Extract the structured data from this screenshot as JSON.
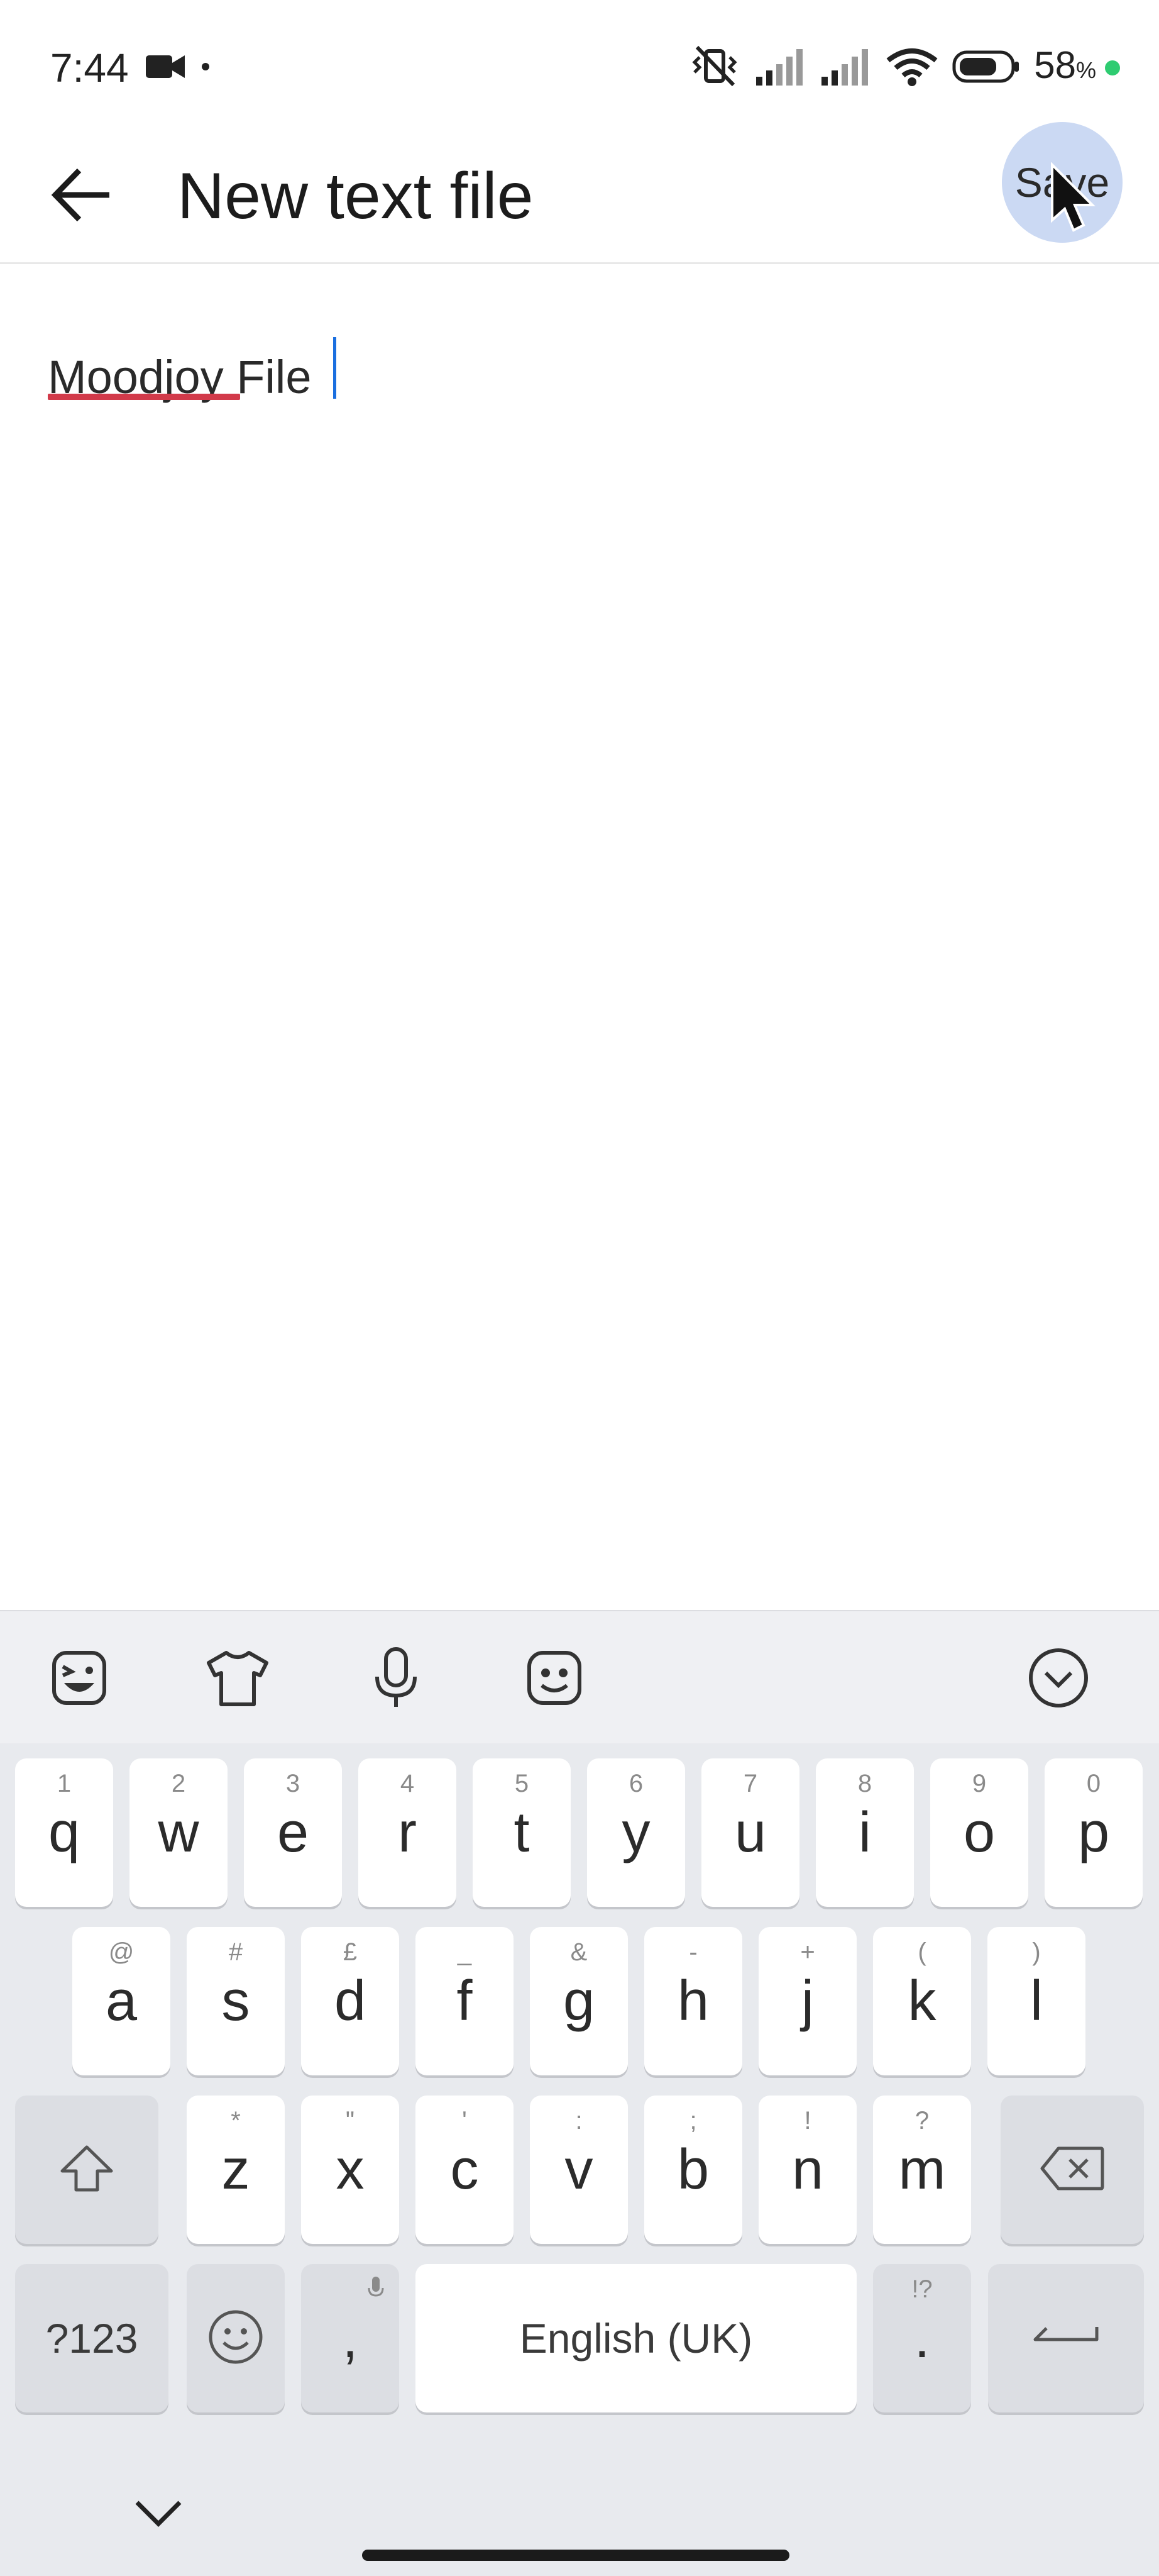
{
  "status_bar": {
    "time": "7:44",
    "battery_percent": "58",
    "battery_unit": "%",
    "icons": [
      "video-camera-icon",
      "notification-dot-icon",
      "vibrate-off-icon",
      "signal-icon",
      "signal-icon",
      "wifi-icon",
      "battery-icon",
      "charging-dot-icon"
    ]
  },
  "app_bar": {
    "title": "New text file",
    "back_icon": "arrow-left-icon",
    "save_label": "Save"
  },
  "editor": {
    "text": "Moodjoy File",
    "misspelled_word": "Moodjoy"
  },
  "keyboard": {
    "toolbar_icons": [
      "sticker-face-icon",
      "tshirt-theme-icon",
      "microphone-icon",
      "emoji-face-icon",
      "collapse-circle-icon"
    ],
    "row1": [
      {
        "key": "q",
        "hint": "1"
      },
      {
        "key": "w",
        "hint": "2"
      },
      {
        "key": "e",
        "hint": "3"
      },
      {
        "key": "r",
        "hint": "4"
      },
      {
        "key": "t",
        "hint": "5"
      },
      {
        "key": "y",
        "hint": "6"
      },
      {
        "key": "u",
        "hint": "7"
      },
      {
        "key": "i",
        "hint": "8"
      },
      {
        "key": "o",
        "hint": "9"
      },
      {
        "key": "p",
        "hint": "0"
      }
    ],
    "row2": [
      {
        "key": "a",
        "hint": "@"
      },
      {
        "key": "s",
        "hint": "#"
      },
      {
        "key": "d",
        "hint": "£"
      },
      {
        "key": "f",
        "hint": "_"
      },
      {
        "key": "g",
        "hint": "&"
      },
      {
        "key": "h",
        "hint": "-"
      },
      {
        "key": "j",
        "hint": "+"
      },
      {
        "key": "k",
        "hint": "("
      },
      {
        "key": "l",
        "hint": ")"
      }
    ],
    "row3": [
      {
        "key": "z",
        "hint": "*"
      },
      {
        "key": "x",
        "hint": "\""
      },
      {
        "key": "c",
        "hint": "'"
      },
      {
        "key": "v",
        "hint": ":"
      },
      {
        "key": "b",
        "hint": ";"
      },
      {
        "key": "n",
        "hint": "!"
      },
      {
        "key": "m",
        "hint": "?"
      }
    ],
    "symbols_label": "?123",
    "comma_label": ",",
    "space_label": "English (UK)",
    "period_label": ".",
    "period_hint": "!?"
  },
  "colors": {
    "accent_caret": "#1a6fe0",
    "spell_underline": "#d23a4a",
    "save_highlight": "#cbd9f3",
    "keyboard_bg": "#e8eaee",
    "charging_dot": "#2ecc71"
  }
}
